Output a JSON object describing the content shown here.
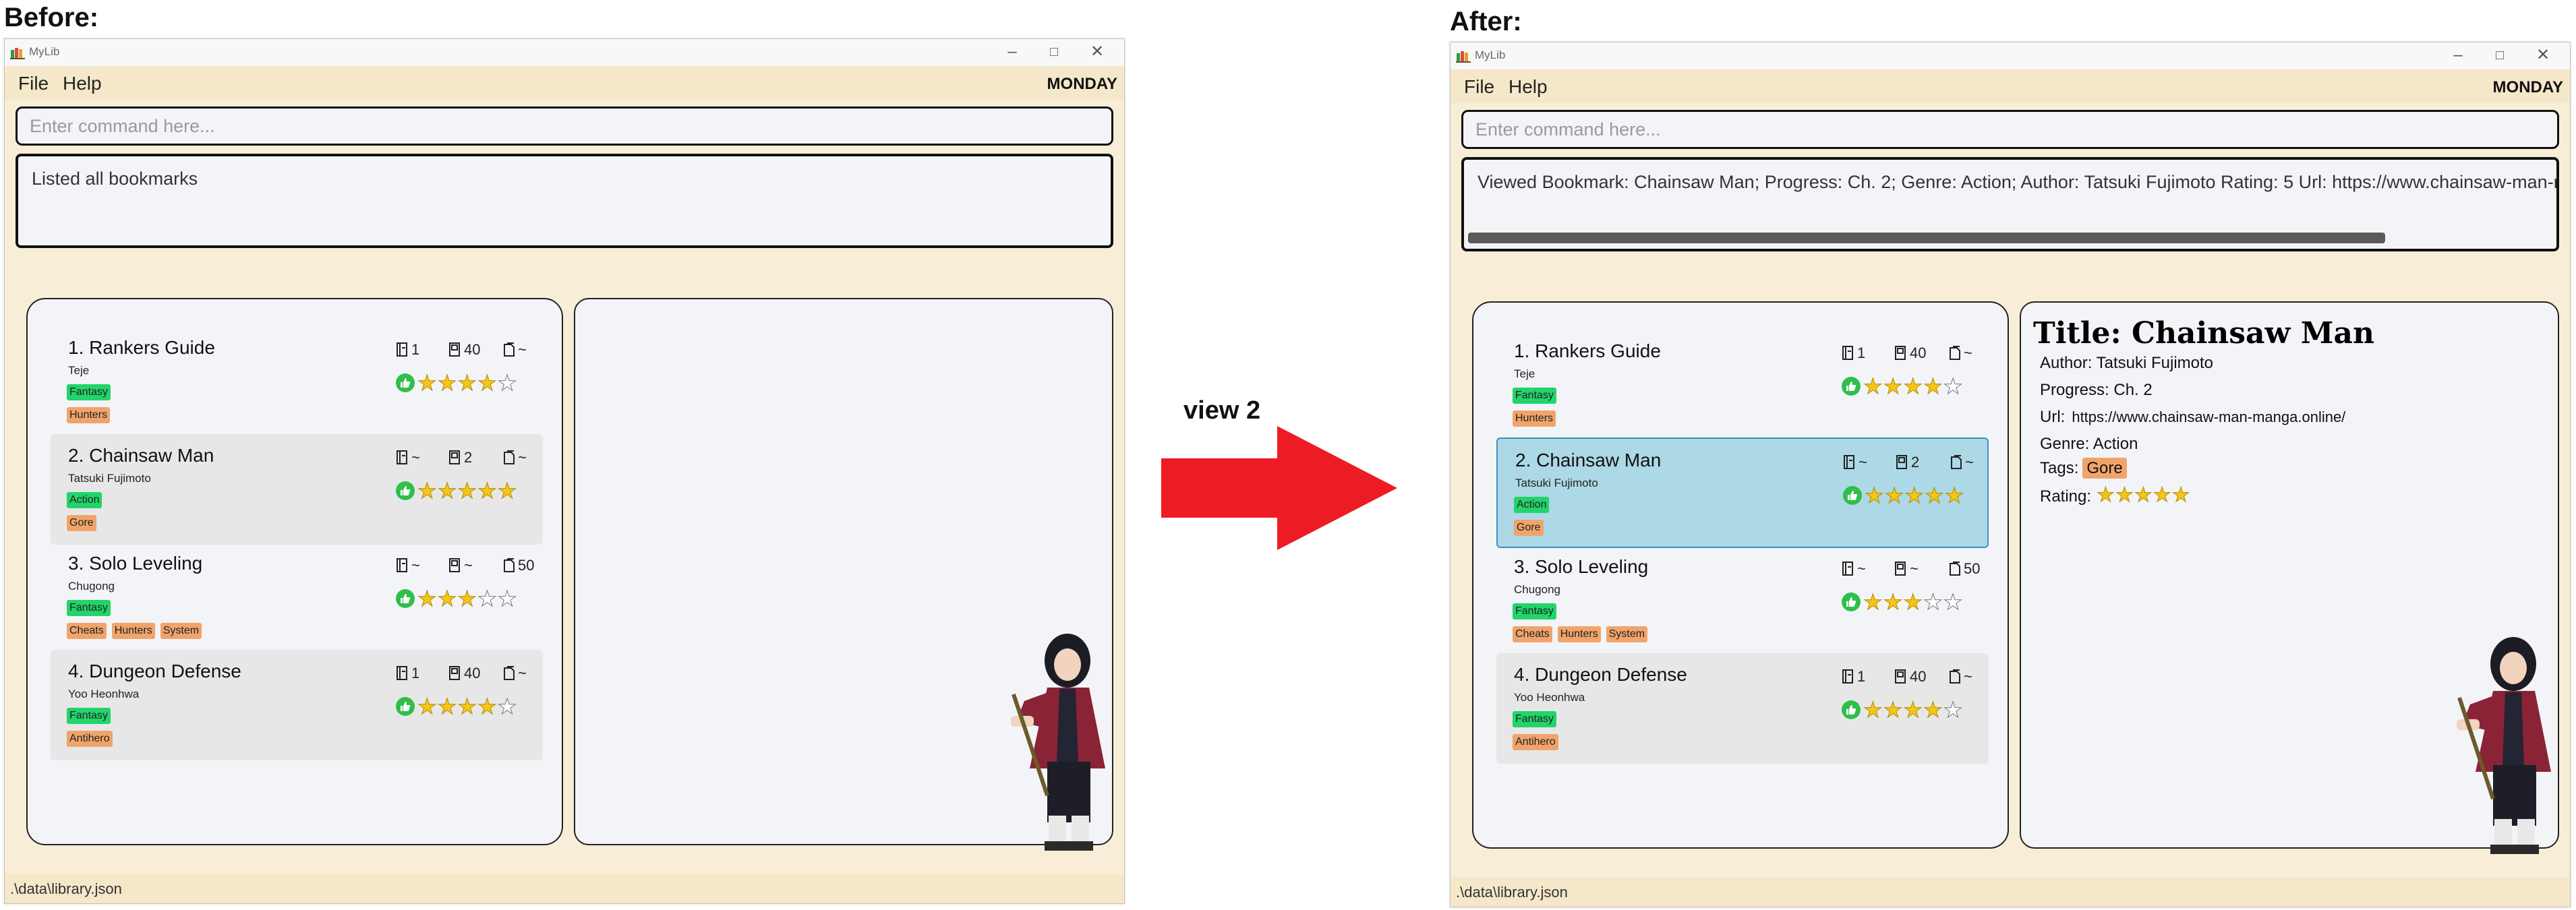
{
  "captions": {
    "before": "Before:",
    "after": "After:",
    "action": "view 2"
  },
  "colors": {
    "arrow": "#ed1c24",
    "window_bg": "#f8eed8",
    "panel_bg": "#f3f4f7",
    "selected": "#add8e6",
    "genre_tag": "#22d46a",
    "other_tag": "#f0a46b",
    "star": "#f5c518"
  },
  "window": {
    "app_title": "MyLib",
    "menu": {
      "file": "File",
      "help": "Help"
    },
    "day": "MONDAY",
    "command_placeholder": "Enter command here...",
    "status_path": ".\\data\\library.json"
  },
  "before": {
    "result": "Listed all bookmarks"
  },
  "after": {
    "result": "Viewed Bookmark: Chainsaw Man; Progress: Ch. 2; Genre: Action; Author: Tatsuki Fujimoto Rating: 5 Url: https://www.chainsaw-man-manga.online/",
    "detail": {
      "title": "Title: Chainsaw Man",
      "author": "Author: Tatsuki Fujimoto",
      "progress": "Progress: Ch. 2",
      "url_label": "Url:",
      "url": "https://www.chainsaw-man-manga.online/",
      "genre": "Genre: Action",
      "tags_label": "Tags:",
      "tag": "Gore",
      "rating_label": "Rating:",
      "rating": 5
    }
  },
  "bookmarks": [
    {
      "title": "1. Rankers Guide",
      "author": "Teje",
      "volume": "1",
      "chapter": "40",
      "page": "~",
      "genre": "Fantasy",
      "tags": [
        "Hunters"
      ],
      "rating": 4
    },
    {
      "title": "2. Chainsaw Man",
      "author": "Tatsuki Fujimoto",
      "volume": "~",
      "chapter": "2",
      "page": "~",
      "genre": "Action",
      "tags": [
        "Gore"
      ],
      "rating": 5
    },
    {
      "title": "3. Solo Leveling",
      "author": "Chugong",
      "volume": "~",
      "chapter": "~",
      "page": "50",
      "genre": "Fantasy",
      "tags": [
        "Cheats",
        "Hunters",
        "System"
      ],
      "rating": 3
    },
    {
      "title": "4. Dungeon Defense",
      "author": "Yoo Heonhwa",
      "volume": "1",
      "chapter": "40",
      "page": "~",
      "genre": "Fantasy",
      "tags": [
        "Antihero"
      ],
      "rating": 4
    }
  ]
}
